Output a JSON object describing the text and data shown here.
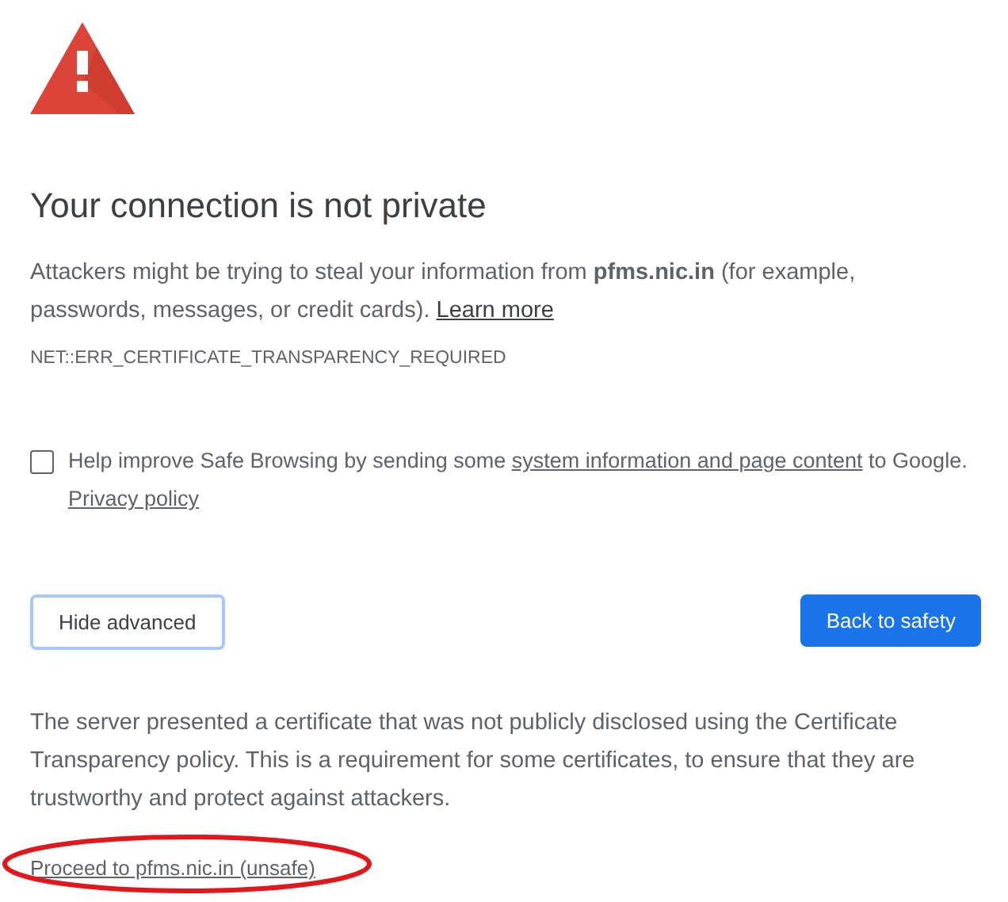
{
  "heading": "Your connection is not private",
  "intro": {
    "text": "Attackers might be trying to steal your information from **pfms.nic.in** (for example, passwords, messages, or credit cards).",
    "link": "Learn more"
  },
  "error_code": "NET::ERR_CERTIFICATE_TRANSPARENCY_REQUIRED",
  "safe_browsing": {
    "checked": false,
    "text_before": "Help improve Safe Browsing by sending some",
    "link": "system information and page content",
    "text_after": "to Google.",
    "privacy_link": "Privacy policy"
  },
  "buttons": [
    {
      "label": "Hide advanced",
      "kind": "secondary"
    },
    {
      "label": "Back to safety",
      "kind": "primary"
    }
  ],
  "details": "The server presented a certificate that was not publicly disclosed using the Certificate Transparency policy. This is a requirement for some certificates, to ensure that they are trustworthy and protect against attackers.",
  "proceed_link": "Proceed to pfms.nic.in (unsafe)"
}
